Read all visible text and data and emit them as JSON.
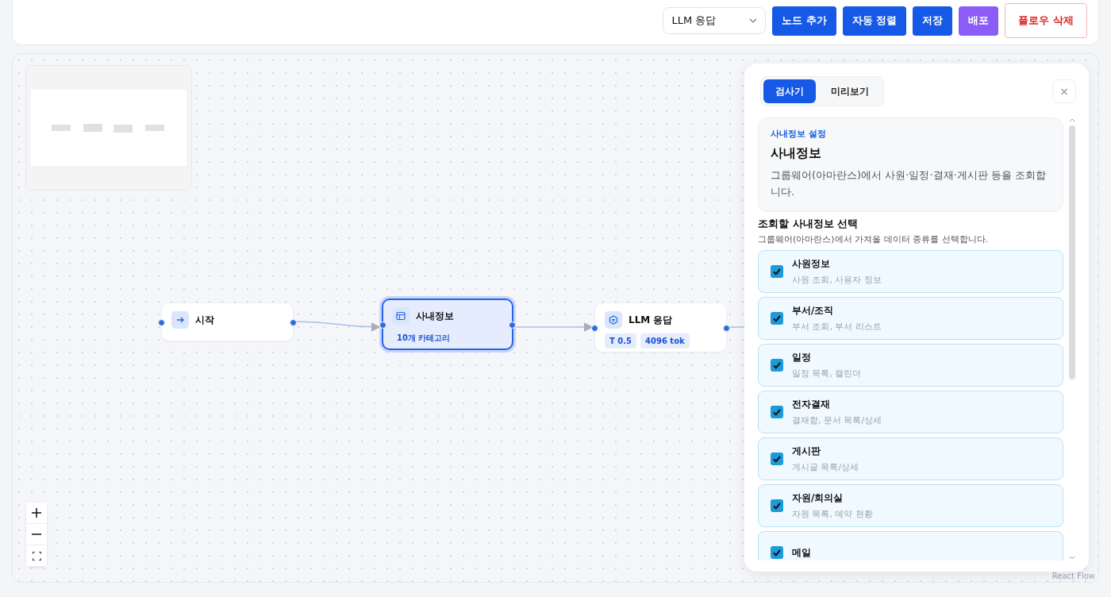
{
  "toolbar": {
    "model_select": {
      "value": "LLM 응답"
    },
    "buttons": [
      {
        "label": "노드 추가",
        "kind": "primary"
      },
      {
        "label": "자동 정렬",
        "kind": "primary"
      },
      {
        "label": "저장",
        "kind": "primary"
      },
      {
        "label": "배포",
        "kind": "accent"
      },
      {
        "label": "플로우 삭제",
        "kind": "danger"
      }
    ]
  },
  "canvas": {
    "nodes": [
      {
        "title": "시작",
        "selected": false
      },
      {
        "title": "사내정보",
        "tags": [
          "10개 카테고리"
        ],
        "selected": true
      },
      {
        "title": "LLM 응답",
        "tags": [
          "T 0.5",
          "4096 tok"
        ],
        "selected": false
      }
    ],
    "attribution": "React Flow"
  },
  "panel": {
    "tabs": [
      {
        "label": "검사기",
        "selected": true
      },
      {
        "label": "미리보기",
        "selected": false
      }
    ],
    "close": "×",
    "header": {
      "eyebrow": "사내정보 설정",
      "title": "사내정보",
      "description": "그룹웨어(아마란스)에서 사원·일정·결재·게시판 등을 조회합니다."
    },
    "section": {
      "title": "조회할 사내정보 선택",
      "description": "그룹웨어(아마란스)에서 가져올 데이터 종류를 선택합니다."
    },
    "options": [
      {
        "label": "사원정보",
        "description": "사원 조회, 사용자 정보",
        "checked": true
      },
      {
        "label": "부서/조직",
        "description": "부서 조회, 부서 리스트",
        "checked": true
      },
      {
        "label": "일정",
        "description": "일정 목록, 캘린더",
        "checked": true
      },
      {
        "label": "전자결재",
        "description": "결재함, 문서 목록/상세",
        "checked": true
      },
      {
        "label": "게시판",
        "description": "게시글 목록/상세",
        "checked": true
      },
      {
        "label": "자원/회의실",
        "description": "자원 목록, 예약 현황",
        "checked": true
      },
      {
        "label": "메일",
        "checked": true
      }
    ]
  }
}
